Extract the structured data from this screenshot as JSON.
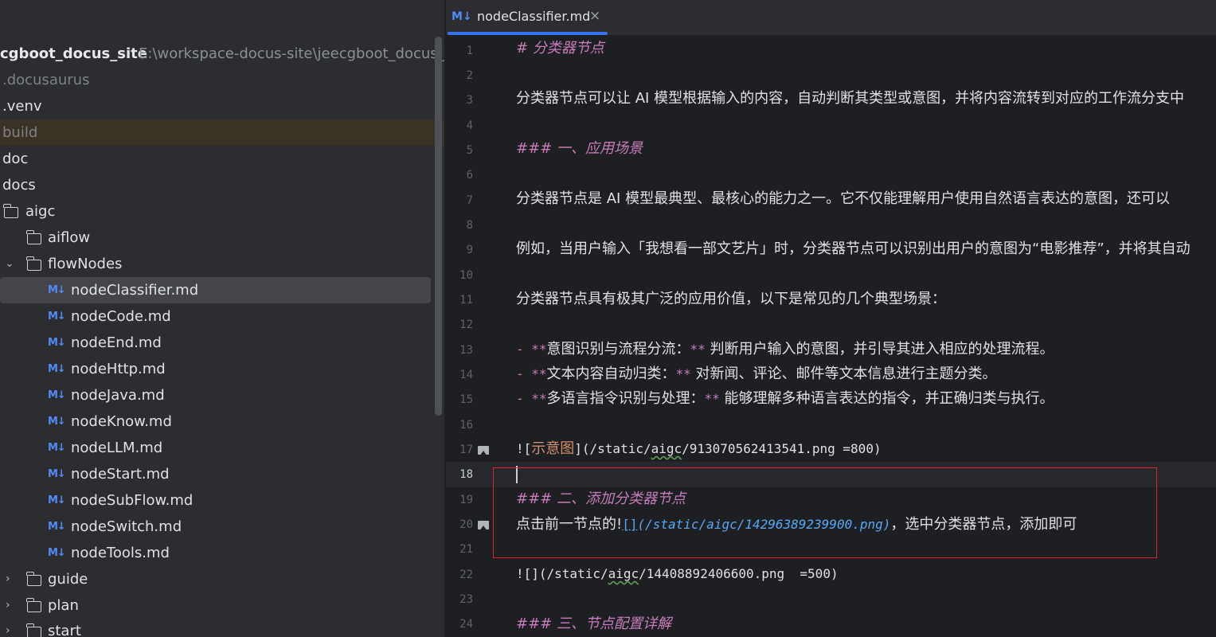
{
  "project": {
    "root_name": "cgboot_docus_site",
    "root_path": "E:\\workspace-docus-site\\jeecgboot_docus_si",
    "items": [
      {
        "label": ".docusaurus",
        "dim": true
      },
      {
        "label": ".venv"
      },
      {
        "label": "build",
        "dim": true
      },
      {
        "label": "doc"
      },
      {
        "label": "docs"
      },
      {
        "label": "aigc"
      },
      {
        "label": "aiflow"
      },
      {
        "label": "flowNodes"
      },
      {
        "label": "nodeClassifier.md"
      },
      {
        "label": "nodeCode.md"
      },
      {
        "label": "nodeEnd.md"
      },
      {
        "label": "nodeHttp.md"
      },
      {
        "label": "nodeJava.md"
      },
      {
        "label": "nodeKnow.md"
      },
      {
        "label": "nodeLLM.md"
      },
      {
        "label": "nodeStart.md"
      },
      {
        "label": "nodeSubFlow.md"
      },
      {
        "label": "nodeSwitch.md"
      },
      {
        "label": "nodeTools.md"
      },
      {
        "label": "guide"
      },
      {
        "label": "plan"
      },
      {
        "label": "start"
      }
    ],
    "md_badge": "M↓"
  },
  "editor": {
    "tab": {
      "badge": "M↓",
      "title": "nodeClassifier.md",
      "close": "×"
    },
    "current_line": 18,
    "line_numbers": [
      "1",
      "2",
      "3",
      "4",
      "5",
      "6",
      "7",
      "8",
      "9",
      "10",
      "11",
      "12",
      "13",
      "14",
      "15",
      "16",
      "17",
      "18",
      "19",
      "20",
      "21",
      "22",
      "23",
      "24"
    ],
    "lines": {
      "l1": "# 分类器节点",
      "l3": "分类器节点可以让 AI 模型根据输入的内容，自动判断其类型或意图，并将内容流转到对应的工作流分支中",
      "l5": "### 一、应用场景",
      "l7": "分类器节点是 AI 模型最典型、最核心的能力之一。它不仅能理解用户使用自然语言表达的意图，还可以",
      "l9": "例如，当用户输入「我想看一部文艺片」时，分类器节点可以识别出用户的意图为“电影推荐”，并将其自动",
      "l11": "分类器节点具有极其广泛的应用价值，以下是常见的几个典型场景：",
      "l13_dash": "- ",
      "l13_bold": "**",
      "l13_text": "意图识别与流程分流：",
      "l13_bold2": "**",
      "l13_rest": " 判断用户输入的意图，并引导其进入相应的处理流程。",
      "l14_dash": "- ",
      "l14_bold": "**",
      "l14_text": "文本内容自动归类：",
      "l14_bold2": "**",
      "l14_rest": " 对新闻、评论、邮件等文本信息进行主题分类。",
      "l15_dash": "- ",
      "l15_bold": "**",
      "l15_text": "多语言指令识别与处理：",
      "l15_bold2": "**",
      "l15_rest": " 能够理解多种语言表达的指令，并正确归类与执行。",
      "l17_a": "![",
      "l17_b": "示意图",
      "l17_c": "](/static/",
      "l17_d": "aigc",
      "l17_e": "/913070562413541.png =800)",
      "l19": "### 二、添加分类器节点",
      "l20_a": "点击前一节点的!",
      "l20_b": "[]",
      "l20_c": "(/static/aigc/14296389239900.png)",
      "l20_d": "，选中分类器节点，添加即可",
      "l22_a": "![](/static/",
      "l22_b": "aigc",
      "l22_c": "/14408892406600.png  =500)",
      "l24": "### 三、节点配置详解"
    }
  }
}
